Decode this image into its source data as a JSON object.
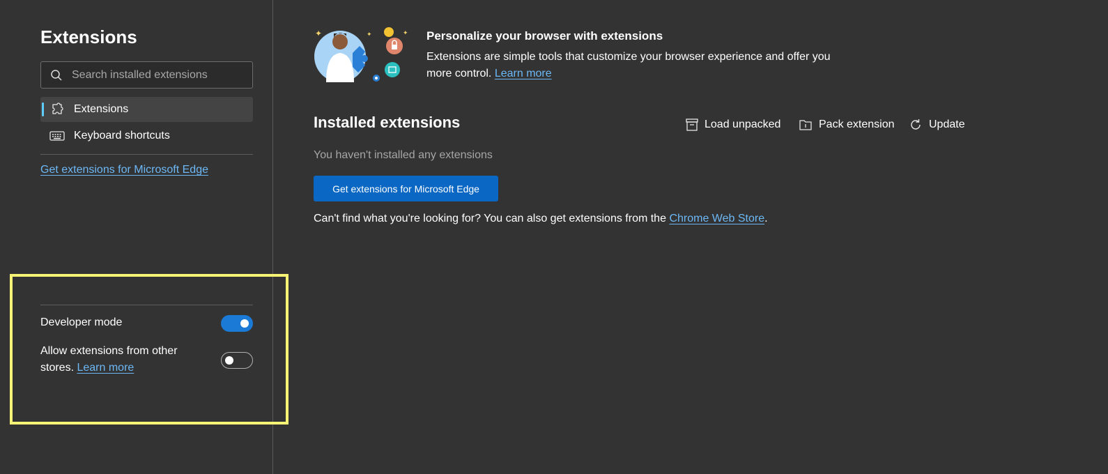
{
  "sidebar": {
    "title": "Extensions",
    "search": {
      "placeholder": "Search installed extensions",
      "value": ""
    },
    "items": [
      {
        "label": "Extensions",
        "icon": "puzzle-icon",
        "active": true
      },
      {
        "label": "Keyboard shortcuts",
        "icon": "keyboard-icon",
        "active": false
      }
    ],
    "get_extensions_link": "Get extensions for Microsoft Edge",
    "settings": {
      "developer_mode": {
        "label": "Developer mode",
        "enabled": true
      },
      "other_stores": {
        "label": "Allow extensions from other stores.",
        "link": "Learn more",
        "enabled": false
      }
    }
  },
  "promo": {
    "title": "Personalize your browser with extensions",
    "description": "Extensions are simple tools that customize your browser experience and offer you more control.",
    "link": "Learn more"
  },
  "main": {
    "title": "Installed extensions",
    "toolbar": {
      "load_unpacked": "Load unpacked",
      "pack_extension": "Pack extension",
      "update": "Update"
    },
    "empty_text": "You haven't installed any extensions",
    "get_button": "Get extensions for Microsoft Edge",
    "help_prefix": "Can't find what you're looking for? You can also get extensions from the",
    "help_link": "Chrome Web Store",
    "help_suffix": "."
  },
  "colors": {
    "background": "#333333",
    "accent": "#60cdff",
    "link": "#6cb8f6",
    "button": "#0a68c4",
    "toggle_on": "#1a7ad6",
    "highlight": "#f6f375"
  }
}
